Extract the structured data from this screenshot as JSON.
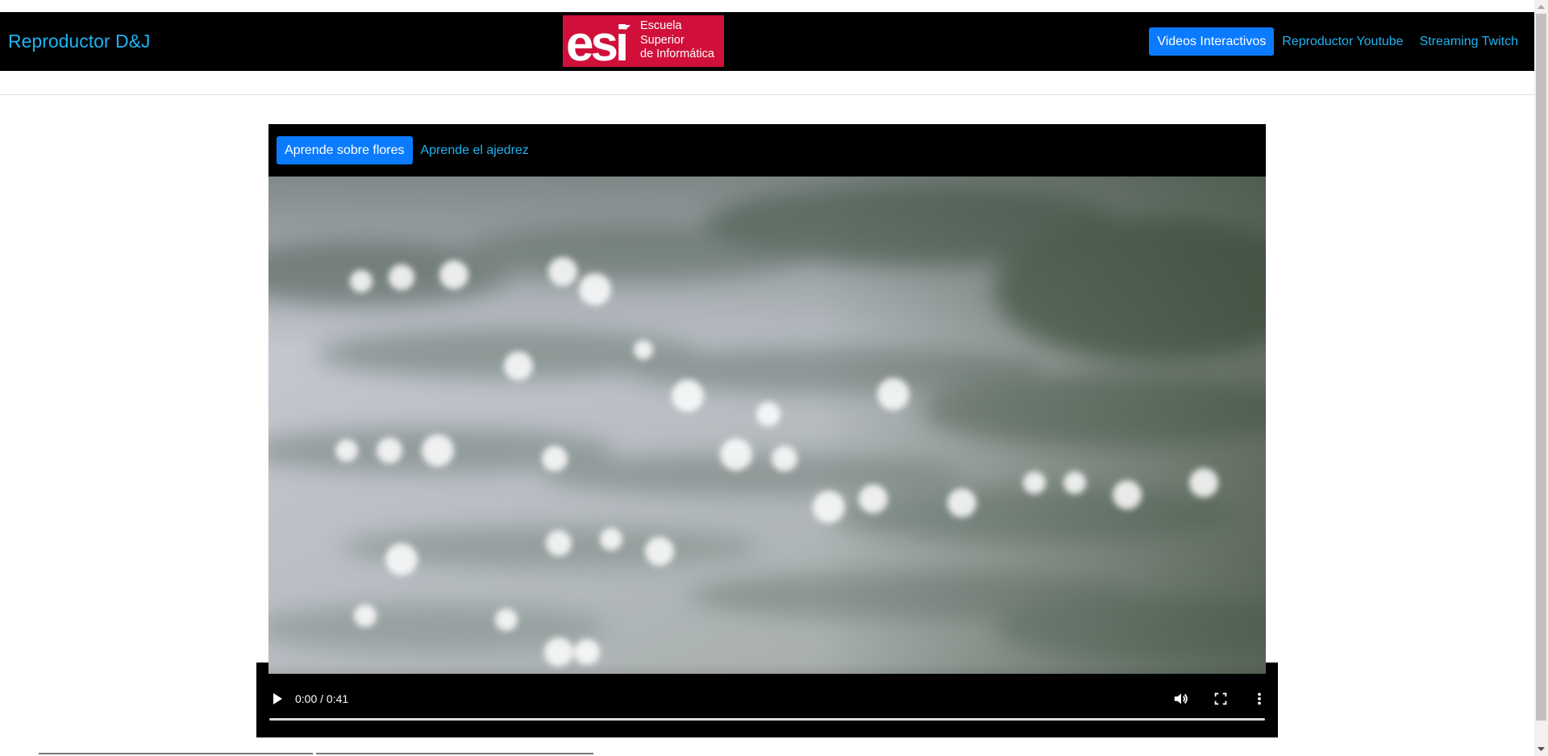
{
  "navbar": {
    "brand": "Reproductor D&J",
    "logo": {
      "letters": "esi",
      "lines": [
        "Escuela",
        "Superior",
        "de Informática"
      ],
      "color": "#d0103a"
    },
    "links": [
      {
        "label": "Videos Interactivos",
        "active": true
      },
      {
        "label": "Reproductor Youtube",
        "active": false
      },
      {
        "label": "Streaming Twitch",
        "active": false
      }
    ]
  },
  "player": {
    "tabs": [
      {
        "label": "Aprende sobre flores",
        "active": true
      },
      {
        "label": "Aprende el ajedrez",
        "active": false
      }
    ],
    "time": "0:00 / 0:41",
    "progress": 0.0,
    "controls": [
      "play-icon",
      "volume-icon",
      "fullscreen-icon",
      "more-options-icon"
    ]
  },
  "colors": {
    "accent": "#0a7bff",
    "link": "#1eb3f3",
    "navbar_bg": "#000000"
  }
}
